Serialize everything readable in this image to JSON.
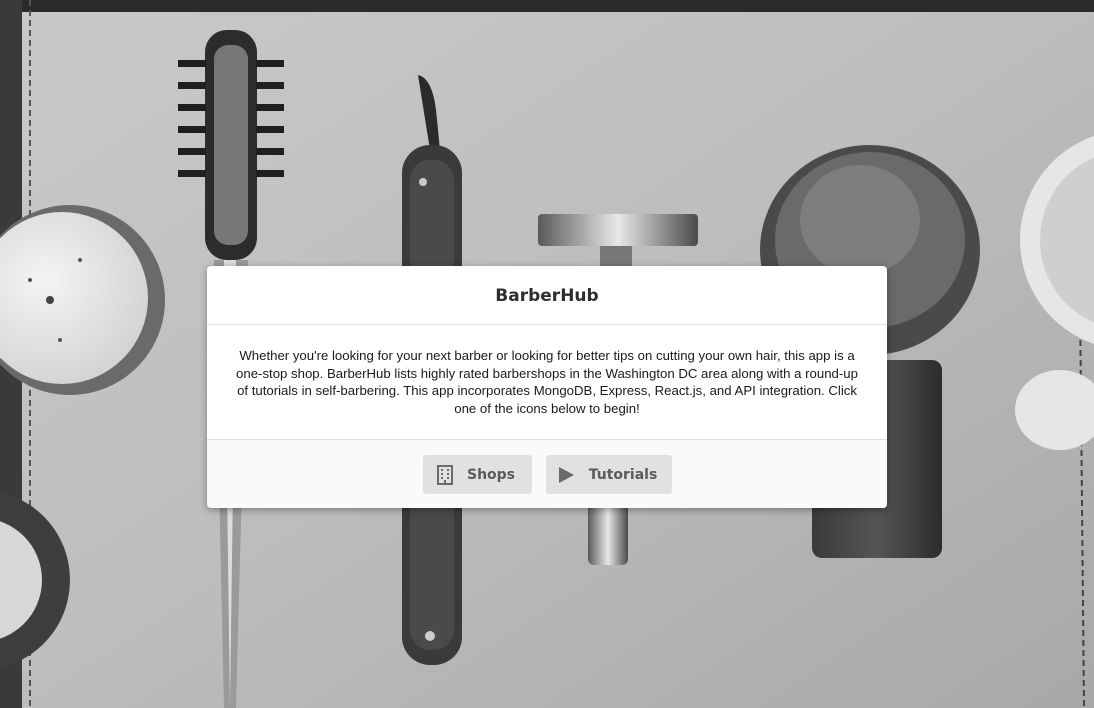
{
  "modal": {
    "title": "BarberHub",
    "description": "Whether you're looking for your next barber or looking for better tips on cutting your own hair, this app is a one-stop shop. BarberHub lists highly rated barbershops in the Washington DC area along with a round-up of tutorials in self-barbering. This app incorporates MongoDB, Express, React.js, and API integration. Click one of the icons below to begin!"
  },
  "actions": {
    "shops": {
      "label": "Shops",
      "icon": "building-icon"
    },
    "tutorials": {
      "label": "Tutorials",
      "icon": "play-icon"
    }
  }
}
